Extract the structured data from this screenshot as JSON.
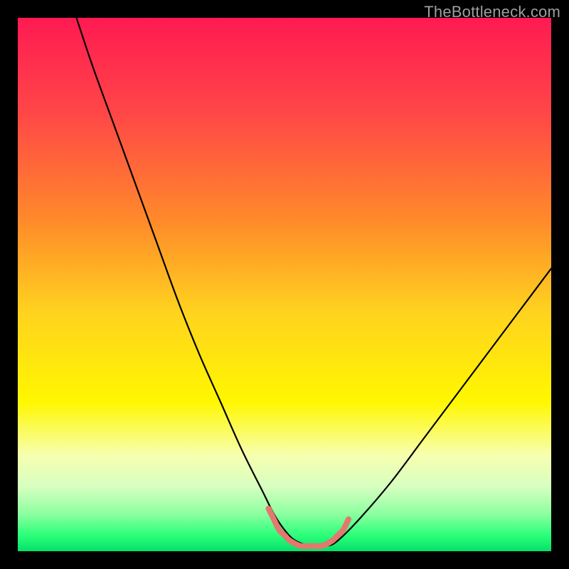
{
  "watermark": {
    "text": "TheBottleneck.com"
  },
  "chart_data": {
    "type": "line",
    "title": "",
    "xlabel": "",
    "ylabel": "",
    "xlim": [
      0,
      100
    ],
    "ylim": [
      0,
      100
    ],
    "grid": false,
    "legend": false,
    "annotations": [],
    "background_gradient": {
      "stops": [
        {
          "offset": 0.0,
          "color": "#ff1a52"
        },
        {
          "offset": 0.18,
          "color": "#ff4747"
        },
        {
          "offset": 0.38,
          "color": "#ff8a2a"
        },
        {
          "offset": 0.55,
          "color": "#ffd21f"
        },
        {
          "offset": 0.72,
          "color": "#fff700"
        },
        {
          "offset": 0.82,
          "color": "#f7ffb0"
        },
        {
          "offset": 0.88,
          "color": "#d6ffc0"
        },
        {
          "offset": 0.93,
          "color": "#8cffa0"
        },
        {
          "offset": 0.97,
          "color": "#2cff7a"
        },
        {
          "offset": 1.0,
          "color": "#05e06a"
        }
      ]
    },
    "series": [
      {
        "name": "bottleneck-curve",
        "color": "#000000",
        "x": [
          11,
          14,
          18,
          22,
          26,
          30,
          34,
          38,
          42,
          46,
          48,
          50,
          52,
          55,
          58,
          60,
          64,
          70,
          76,
          82,
          88,
          94,
          100
        ],
        "y": [
          100,
          91,
          80,
          69,
          58,
          47,
          37,
          28,
          19,
          11,
          7,
          4,
          2,
          1,
          1,
          2,
          6,
          13,
          21,
          29,
          37,
          45,
          53
        ]
      },
      {
        "name": "valley-highlight",
        "color": "#e4776e",
        "stroke_width": 8,
        "x": [
          47,
          48,
          49,
          50,
          51,
          53,
          55,
          57,
          59,
          60,
          61,
          62
        ],
        "y": [
          8,
          6,
          4,
          3,
          2,
          1,
          1,
          1,
          2,
          3,
          4,
          6
        ]
      }
    ]
  }
}
